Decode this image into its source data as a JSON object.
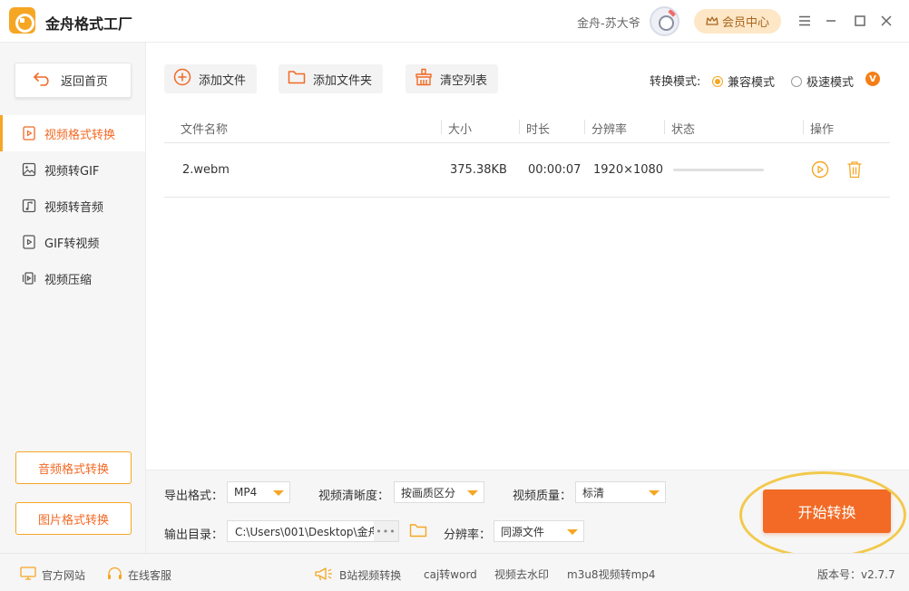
{
  "app": {
    "title": "金舟格式工厂"
  },
  "user": {
    "name": "金舟-苏大爷",
    "vip_label": "会员中心"
  },
  "sidebar": {
    "back_label": "返回首页",
    "items": [
      {
        "label": "视频格式转换",
        "icon": "video-icon",
        "active": true
      },
      {
        "label": "视频转GIF",
        "icon": "image-icon",
        "active": false
      },
      {
        "label": "视频转音频",
        "icon": "music-icon",
        "active": false
      },
      {
        "label": "GIF转视频",
        "icon": "play-icon",
        "active": false
      },
      {
        "label": "视频压缩",
        "icon": "compress-icon",
        "active": false
      }
    ],
    "audio_btn": "音频格式转换",
    "image_btn": "图片格式转换"
  },
  "toolbar": {
    "add_file": "添加文件",
    "add_folder": "添加文件夹",
    "clear_list": "清空列表",
    "mode_label": "转换模式:",
    "mode_compat": "兼容模式",
    "mode_fast": "极速模式",
    "mode_selected": "兼容模式",
    "vip_badge": "V"
  },
  "table": {
    "headers": [
      "文件名称",
      "大小",
      "时长",
      "分辨率",
      "状态",
      "操作"
    ],
    "rows": [
      {
        "name": "2.webm",
        "size": "375.38KB",
        "duration": "00:00:07",
        "resolution": "1920×1080",
        "progress": 0
      }
    ]
  },
  "settings": {
    "format_label": "导出格式：",
    "format_value": "MP4",
    "clarity_label": "视频清晰度：",
    "clarity_value": "按画质区分",
    "quality_label": "视频质量：",
    "quality_value": "标清",
    "output_label": "输出目录：",
    "output_value": "C:\\Users\\001\\Desktop\\金舟",
    "resolution_label": "分辨率：",
    "resolution_value": "同源文件",
    "dots": "•••",
    "start_label": "开始转换"
  },
  "footer": {
    "website": "官方网站",
    "service": "在线客服",
    "links": [
      "B站视频转换",
      "caj转word",
      "视频去水印",
      "m3u8视频转mp4"
    ],
    "version": "版本号：v2.7.7"
  },
  "colors": {
    "accent": "#f26a25",
    "gold": "#f5a623"
  }
}
